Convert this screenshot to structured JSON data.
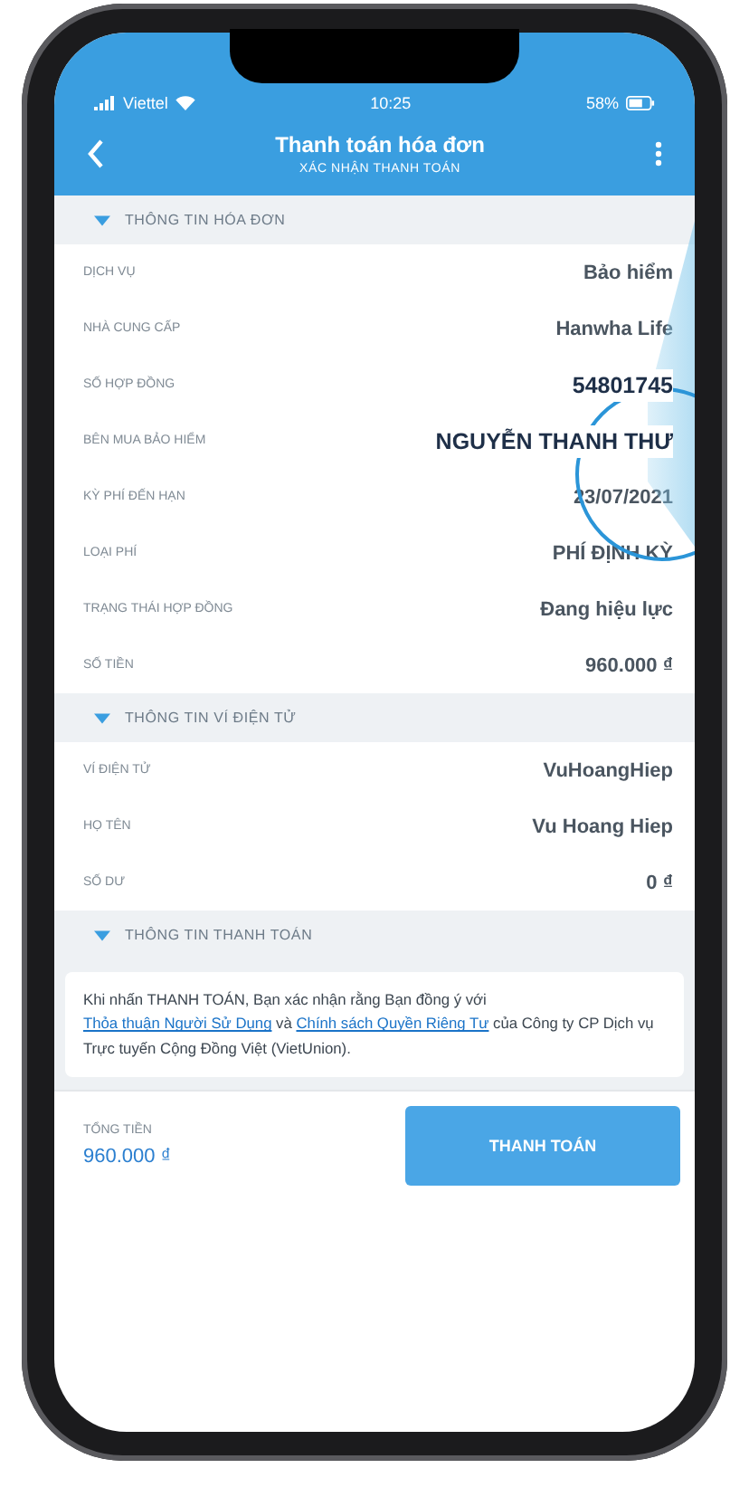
{
  "status_bar": {
    "carrier": "Viettel",
    "time": "10:25",
    "battery": "58%"
  },
  "header": {
    "title": "Thanh toán hóa đơn",
    "subtitle": "XÁC NHẬN THANH TOÁN"
  },
  "sections": [
    {
      "title": "THÔNG TIN HÓA ĐƠN",
      "expanded": true,
      "rows": [
        {
          "label": "DỊCH VỤ",
          "value": "Bảo hiểm",
          "magnified": false
        },
        {
          "label": "NHÀ CUNG CẤP",
          "value": "Hanwha Life",
          "magnified": false
        },
        {
          "label": "SỐ HỢP ĐỒNG",
          "value": "54801745",
          "magnified": true
        },
        {
          "label": "BÊN MUA BẢO HIỂM",
          "value": "NGUYỄN THANH THƯ",
          "magnified": true
        },
        {
          "label": "KỲ PHÍ ĐẾN HẠN",
          "value": "23/07/2021",
          "magnified": false
        },
        {
          "label": "LOẠI PHÍ",
          "value": "PHÍ ĐỊNH KỲ",
          "magnified": false
        },
        {
          "label": "TRẠNG THÁI HỢP ĐỒNG",
          "value": "Đang hiệu lực",
          "magnified": false
        },
        {
          "label": "SỐ TIỀN",
          "value": "960.000 ₫",
          "magnified": false
        }
      ]
    },
    {
      "title": "THÔNG TIN VÍ ĐIỆN TỬ",
      "expanded": true,
      "rows": [
        {
          "label": "VÍ ĐIỆN TỬ",
          "value": "VuHoangHiep",
          "magnified": false
        },
        {
          "label": "HỌ TÊN",
          "value": "Vu Hoang Hiep",
          "magnified": false
        },
        {
          "label": "SỐ DƯ",
          "value": "0 ₫",
          "magnified": false
        }
      ]
    },
    {
      "title": "THÔNG TIN THANH TOÁN",
      "expanded": true,
      "notice": [
        {
          "kind": "text",
          "text": "Khi nhấn THANH TOÁN, Bạn xác nhận rằng Bạn đồng ý với "
        },
        {
          "kind": "link",
          "text": "Thỏa thuận Người Sử Dụng"
        },
        {
          "kind": "text",
          "text": " và "
        },
        {
          "kind": "link",
          "text": "Chính sách Quyền Riêng Tư"
        },
        {
          "kind": "text",
          "text": " của Công ty CP Dịch vụ Trực tuyến Cộng Đồng Việt (VietUnion)."
        }
      ]
    }
  ],
  "footer": {
    "total_label": "TỔNG TIỀN",
    "total_value": "960.000 ₫",
    "button": "THANH TOÁN"
  }
}
